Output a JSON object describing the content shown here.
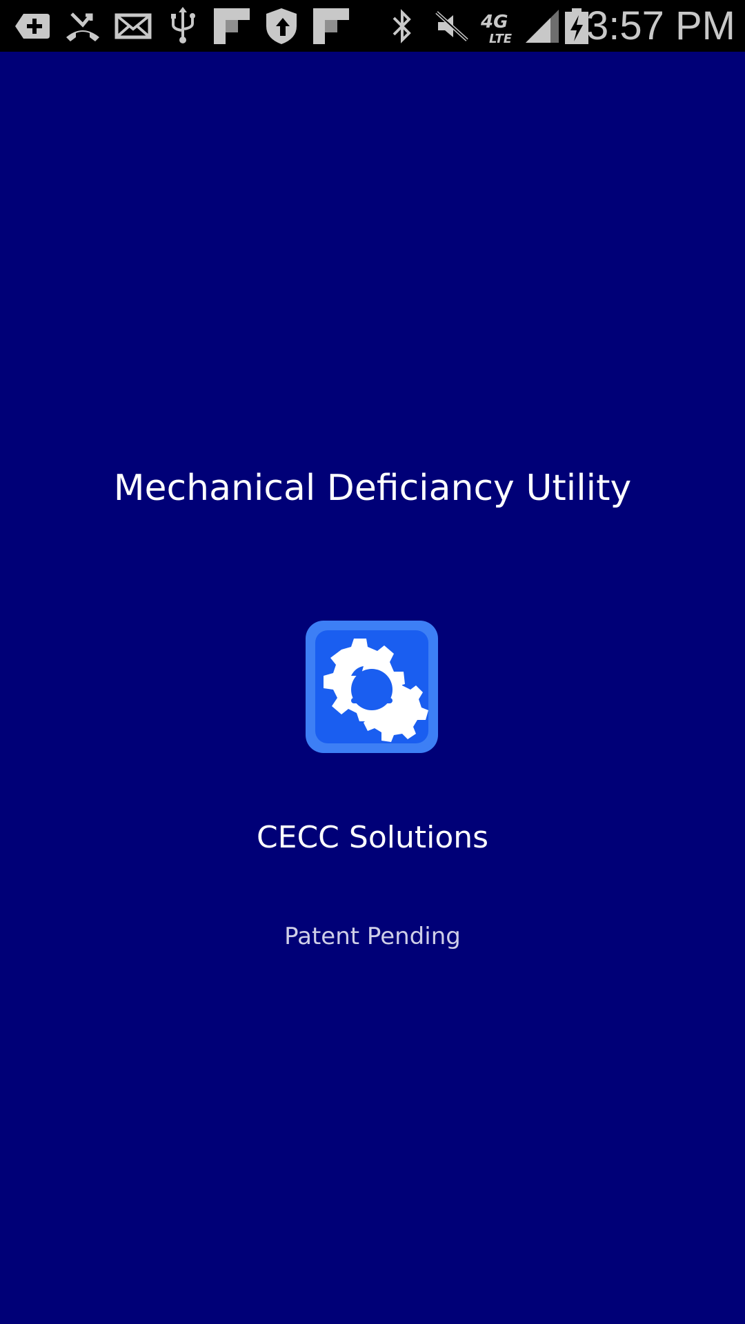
{
  "status_bar": {
    "time": "3:57 PM",
    "icons": [
      "add-icon",
      "missed-call-icon",
      "mail-icon",
      "usb-icon",
      "flipboard-icon",
      "shield-update-icon",
      "flipboard-icon",
      "bluetooth-icon",
      "mute-icon",
      "4g-lte-icon",
      "signal-icon",
      "battery-charging-icon"
    ]
  },
  "splash": {
    "title": "Mechanical Deficiancy Utility",
    "app_icon": "gears-icon",
    "company": "CECC Solutions",
    "notice": "Patent Pending"
  },
  "colors": {
    "background": "#000077",
    "status_bar": "#000000",
    "icon_frame": "#3d7ff5",
    "icon_inner": "#1a5ef0",
    "text": "#ffffff",
    "subtle_text": "#cfcfe8"
  }
}
